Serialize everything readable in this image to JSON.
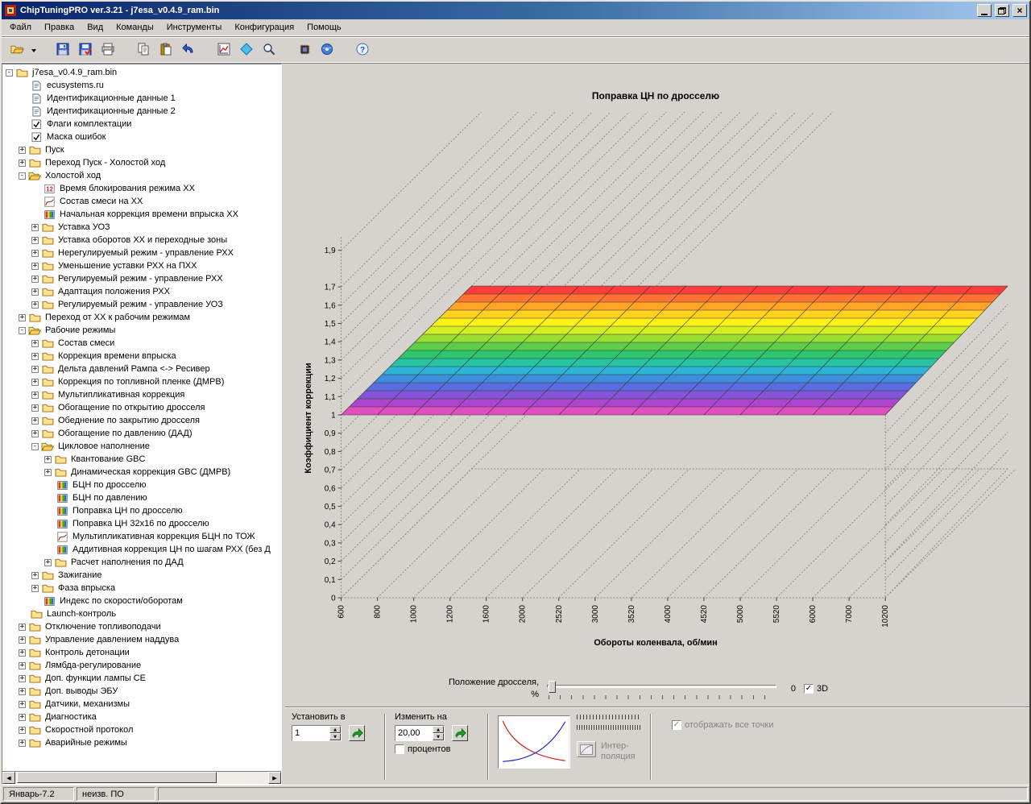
{
  "window": {
    "title": "ChipTuningPRO ver.3.21 - j7esa_v0.4.9_ram.bin"
  },
  "menu": {
    "items": [
      "Файл",
      "Правка",
      "Вид",
      "Команды",
      "Инструменты",
      "Конфигурация",
      "Помощь"
    ]
  },
  "toolbar": {
    "groups": [
      [
        "open"
      ],
      [
        "save",
        "save-as",
        "print"
      ],
      [
        "copy",
        "paste",
        "undo"
      ],
      [
        "chart",
        "compare",
        "zoom"
      ],
      [
        "programmer",
        "firmware"
      ],
      [
        "help"
      ]
    ]
  },
  "tree": {
    "items": [
      {
        "l": 0,
        "e": "-",
        "i": "folder",
        "t": "j7esa_v0.4.9_ram.bin"
      },
      {
        "l": 1,
        "e": "",
        "i": "doc",
        "t": "ecusystems.ru"
      },
      {
        "l": 1,
        "e": "",
        "i": "doc",
        "t": "Идентификационные данные 1"
      },
      {
        "l": 1,
        "e": "",
        "i": "doc",
        "t": "Идентификационные данные 2"
      },
      {
        "l": 1,
        "e": "",
        "i": "check",
        "t": "Флаги комплектации"
      },
      {
        "l": 1,
        "e": "",
        "i": "check",
        "t": "Маска ошибок"
      },
      {
        "l": 1,
        "e": "+",
        "i": "folder",
        "t": "Пуск"
      },
      {
        "l": 1,
        "e": "+",
        "i": "folder",
        "t": "Переход Пуск - Холостой ход"
      },
      {
        "l": 1,
        "e": "-",
        "i": "folderOpen",
        "t": "Холостой ход"
      },
      {
        "l": 2,
        "e": "",
        "i": "num12",
        "t": "Время блокирования режима XX"
      },
      {
        "l": 2,
        "e": "",
        "i": "curve",
        "t": "Состав смеси на XX"
      },
      {
        "l": 2,
        "e": "",
        "i": "map",
        "t": "Начальная коррекция времени впрыска XX"
      },
      {
        "l": 2,
        "e": "+",
        "i": "folder",
        "t": "Уставка УОЗ"
      },
      {
        "l": 2,
        "e": "+",
        "i": "folder",
        "t": "Уставка оборотов XX и переходные зоны"
      },
      {
        "l": 2,
        "e": "+",
        "i": "folder",
        "t": "Нерегулируемый режим - управление РХХ"
      },
      {
        "l": 2,
        "e": "+",
        "i": "folder",
        "t": "Уменьшение уставки РХХ на ПХХ"
      },
      {
        "l": 2,
        "e": "+",
        "i": "folder",
        "t": "Регулируемый режим - управление РХХ"
      },
      {
        "l": 2,
        "e": "+",
        "i": "folder",
        "t": "Адаптация положения РХХ"
      },
      {
        "l": 2,
        "e": "+",
        "i": "folder",
        "t": "Регулируемый режим - управление УОЗ"
      },
      {
        "l": 1,
        "e": "+",
        "i": "folder",
        "t": "Переход от XX к рабочим режимам"
      },
      {
        "l": 1,
        "e": "-",
        "i": "folderOpen",
        "t": "Рабочие режимы"
      },
      {
        "l": 2,
        "e": "+",
        "i": "folder",
        "t": "Состав смеси"
      },
      {
        "l": 2,
        "e": "+",
        "i": "folder",
        "t": "Коррекция времени впрыска"
      },
      {
        "l": 2,
        "e": "+",
        "i": "folder",
        "t": "Дельта давлений Рампа <-> Ресивер"
      },
      {
        "l": 2,
        "e": "+",
        "i": "folder",
        "t": "Коррекция по топливной пленке (ДМРВ)"
      },
      {
        "l": 2,
        "e": "+",
        "i": "folder",
        "t": "Мультипликативная коррекция"
      },
      {
        "l": 2,
        "e": "+",
        "i": "folder",
        "t": "Обогащение по открытию дросселя"
      },
      {
        "l": 2,
        "e": "+",
        "i": "folder",
        "t": "Обеднение по закрытию дросселя"
      },
      {
        "l": 2,
        "e": "+",
        "i": "folder",
        "t": "Обогащение по давлению (ДАД)"
      },
      {
        "l": 2,
        "e": "-",
        "i": "folderOpen",
        "t": "Цикловое наполнение"
      },
      {
        "l": 3,
        "e": "+",
        "i": "folder",
        "t": "Квантование GBC"
      },
      {
        "l": 3,
        "e": "+",
        "i": "folder",
        "t": "Динамическая коррекция GBC (ДМРВ)"
      },
      {
        "l": 3,
        "e": "",
        "i": "map",
        "t": "БЦН по дросселю"
      },
      {
        "l": 3,
        "e": "",
        "i": "map",
        "t": "БЦН по давлению"
      },
      {
        "l": 3,
        "e": "",
        "i": "map",
        "t": "Поправка ЦН по дросселю"
      },
      {
        "l": 3,
        "e": "",
        "i": "map",
        "t": "Поправка ЦН 32x16 по дросселю"
      },
      {
        "l": 3,
        "e": "",
        "i": "curve",
        "t": "Мультипликативная коррекция БЦН по ТОЖ"
      },
      {
        "l": 3,
        "e": "",
        "i": "map",
        "t": "Аддитивная коррекция ЦН по шагам РХХ (без Д"
      },
      {
        "l": 3,
        "e": "+",
        "i": "folder",
        "t": "Расчет наполнения по ДАД"
      },
      {
        "l": 2,
        "e": "+",
        "i": "folder",
        "t": "Зажигание"
      },
      {
        "l": 2,
        "e": "+",
        "i": "folder",
        "t": "Фаза впрыска"
      },
      {
        "l": 2,
        "e": "",
        "i": "map",
        "t": "Индекс по скорости/оборотам"
      },
      {
        "l": 1,
        "e": "",
        "i": "folder",
        "t": "Launch-контроль"
      },
      {
        "l": 1,
        "e": "+",
        "i": "folder",
        "t": "Отключение топливоподачи"
      },
      {
        "l": 1,
        "e": "+",
        "i": "folder",
        "t": "Управление давлением наддува"
      },
      {
        "l": 1,
        "e": "+",
        "i": "folder",
        "t": "Контроль детонации"
      },
      {
        "l": 1,
        "e": "+",
        "i": "folder",
        "t": "Лямбда-регулирование"
      },
      {
        "l": 1,
        "e": "+",
        "i": "folder",
        "t": "Доп. функции лампы CE"
      },
      {
        "l": 1,
        "e": "+",
        "i": "folder",
        "t": "Доп. выводы ЭБУ"
      },
      {
        "l": 1,
        "e": "+",
        "i": "folder",
        "t": "Датчики, механизмы"
      },
      {
        "l": 1,
        "e": "+",
        "i": "folder",
        "t": "Диагностика"
      },
      {
        "l": 1,
        "e": "+",
        "i": "folder",
        "t": "Скоростной протокол"
      },
      {
        "l": 1,
        "e": "+",
        "i": "folder",
        "t": "Аварийные режимы"
      }
    ]
  },
  "chart_data": {
    "type": "heatmap",
    "subtype": "3d-surface",
    "title": "Поправка ЦН по дросселю",
    "xlabel": "Обороты коленвала, об/мин",
    "ylabel": "Коэффициент коррекции",
    "x_ticks": [
      "600",
      "800",
      "1000",
      "1200",
      "1600",
      "2000",
      "2520",
      "3000",
      "3520",
      "4000",
      "4520",
      "5000",
      "5520",
      "6000",
      "7000",
      "10200"
    ],
    "y_ticks": [
      "1,9",
      "1,7",
      "1,6",
      "1,5",
      "1,4",
      "1,3",
      "1,2",
      "1,1",
      "1",
      "0,9",
      "0,8",
      "0,7",
      "0,6",
      "0,5",
      "0,4",
      "0,3",
      "0,2",
      "0,1",
      "0"
    ],
    "ylim": [
      0,
      1.9
    ],
    "rows": 16,
    "z_constant": 1,
    "note": "flat rainbow surface: correction coefficient = 1 for every rpm/throttle cell",
    "grid": "dashed 3D box grid",
    "surface_colors": [
      "#ff3c3c",
      "#ff7430",
      "#ffa426",
      "#ffd21f",
      "#fff21a",
      "#d4ee22",
      "#9ade33",
      "#5cce4a",
      "#2fc46e",
      "#27c4a4",
      "#2db4d4",
      "#3f8ede",
      "#5a6ce0",
      "#8156d8",
      "#ad46ce",
      "#e04fc0"
    ]
  },
  "controls": {
    "throttle": {
      "label_line1": "Положение дросселя,",
      "label_line2": "%",
      "value": "0",
      "checkbox_3d_label": "3D",
      "checkbox_3d_checked": true
    },
    "set_to": {
      "label": "Установить в",
      "value": "1"
    },
    "change_by": {
      "label": "Изменить на",
      "value": "20,00",
      "percent_label": "процентов",
      "percent_checked": false
    },
    "interpolation": {
      "label_line1": "Интер-",
      "label_line2": "поляция"
    },
    "show_all_points": {
      "label": "отображать все точки",
      "checked": true,
      "disabled": true
    }
  },
  "statusbar": {
    "cells": [
      "Январь-7.2",
      "неизв. ПО"
    ]
  }
}
